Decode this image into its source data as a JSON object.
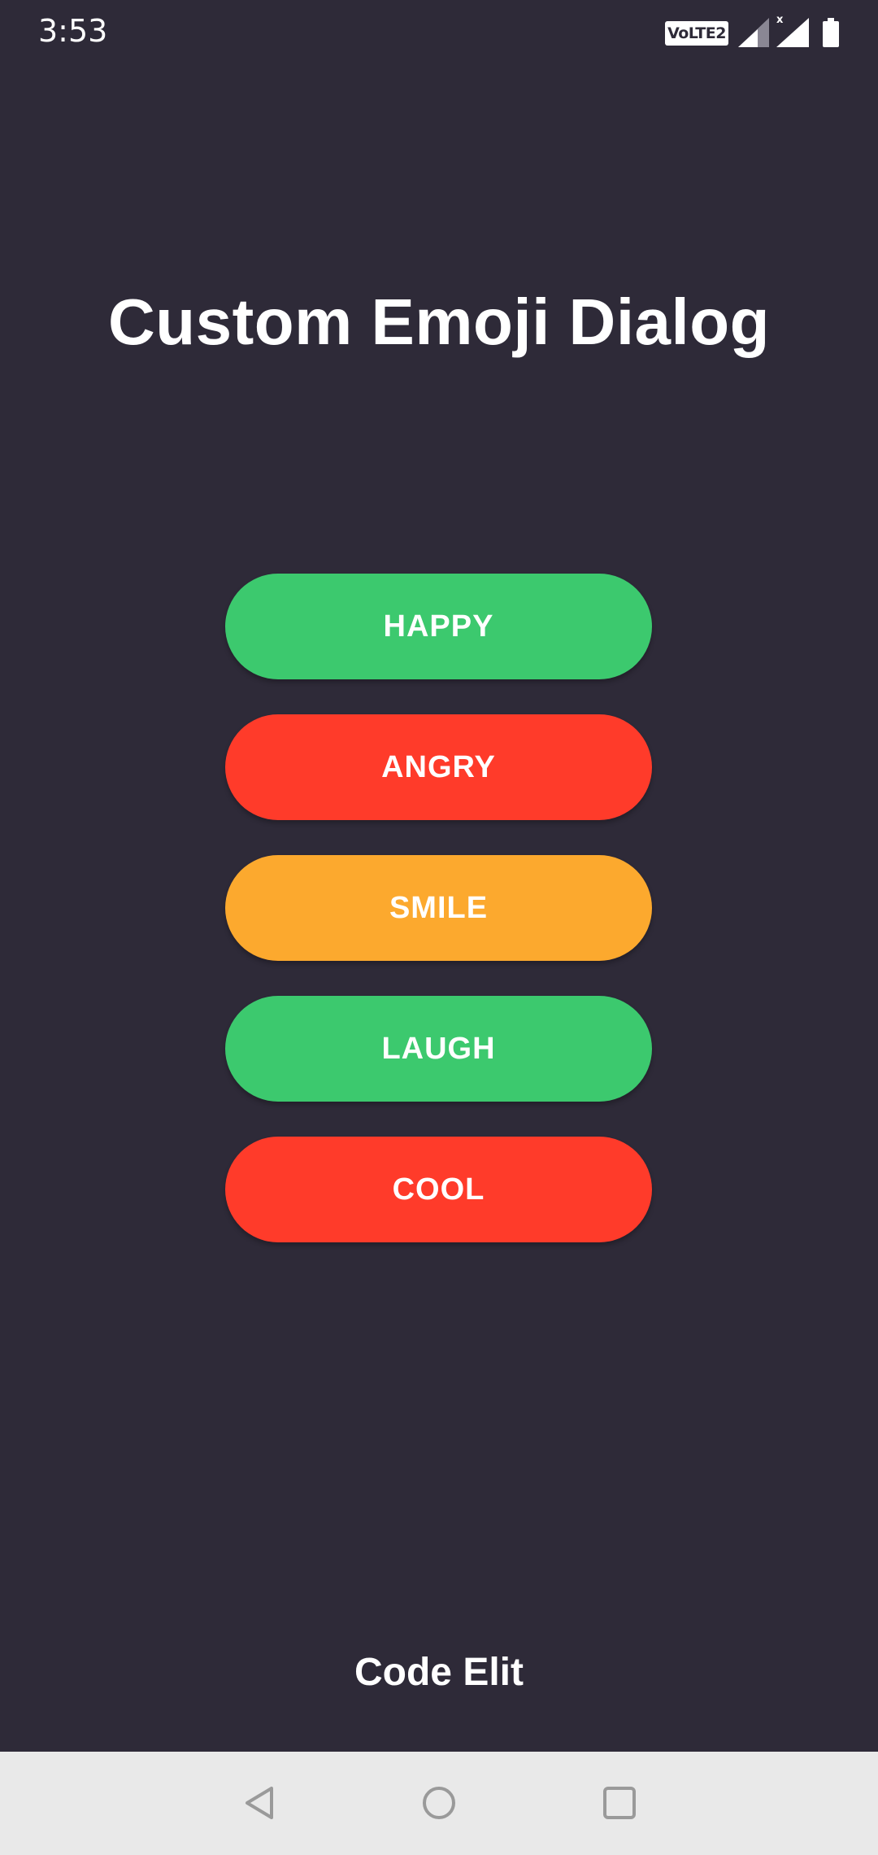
{
  "status_bar": {
    "time": "3:53",
    "network_badge": "VoLTE2",
    "icons": [
      "signal-icon",
      "signal-icon",
      "battery-icon"
    ]
  },
  "title": "Custom Emoji Dialog",
  "buttons": [
    {
      "label": "HAPPY",
      "color": "#3cc96e"
    },
    {
      "label": "ANGRY",
      "color": "#ff3b2a"
    },
    {
      "label": "SMILE",
      "color": "#fca92e"
    },
    {
      "label": "LAUGH",
      "color": "#3cc96e"
    },
    {
      "label": "COOL",
      "color": "#ff3b2a"
    }
  ],
  "footer": "Code Elit",
  "colors": {
    "background": "#2e2a38",
    "nav_bar": "#e9e9e9",
    "text": "#ffffff"
  },
  "nav_bar": {
    "icons": [
      "back-icon",
      "home-icon",
      "recents-icon"
    ]
  }
}
